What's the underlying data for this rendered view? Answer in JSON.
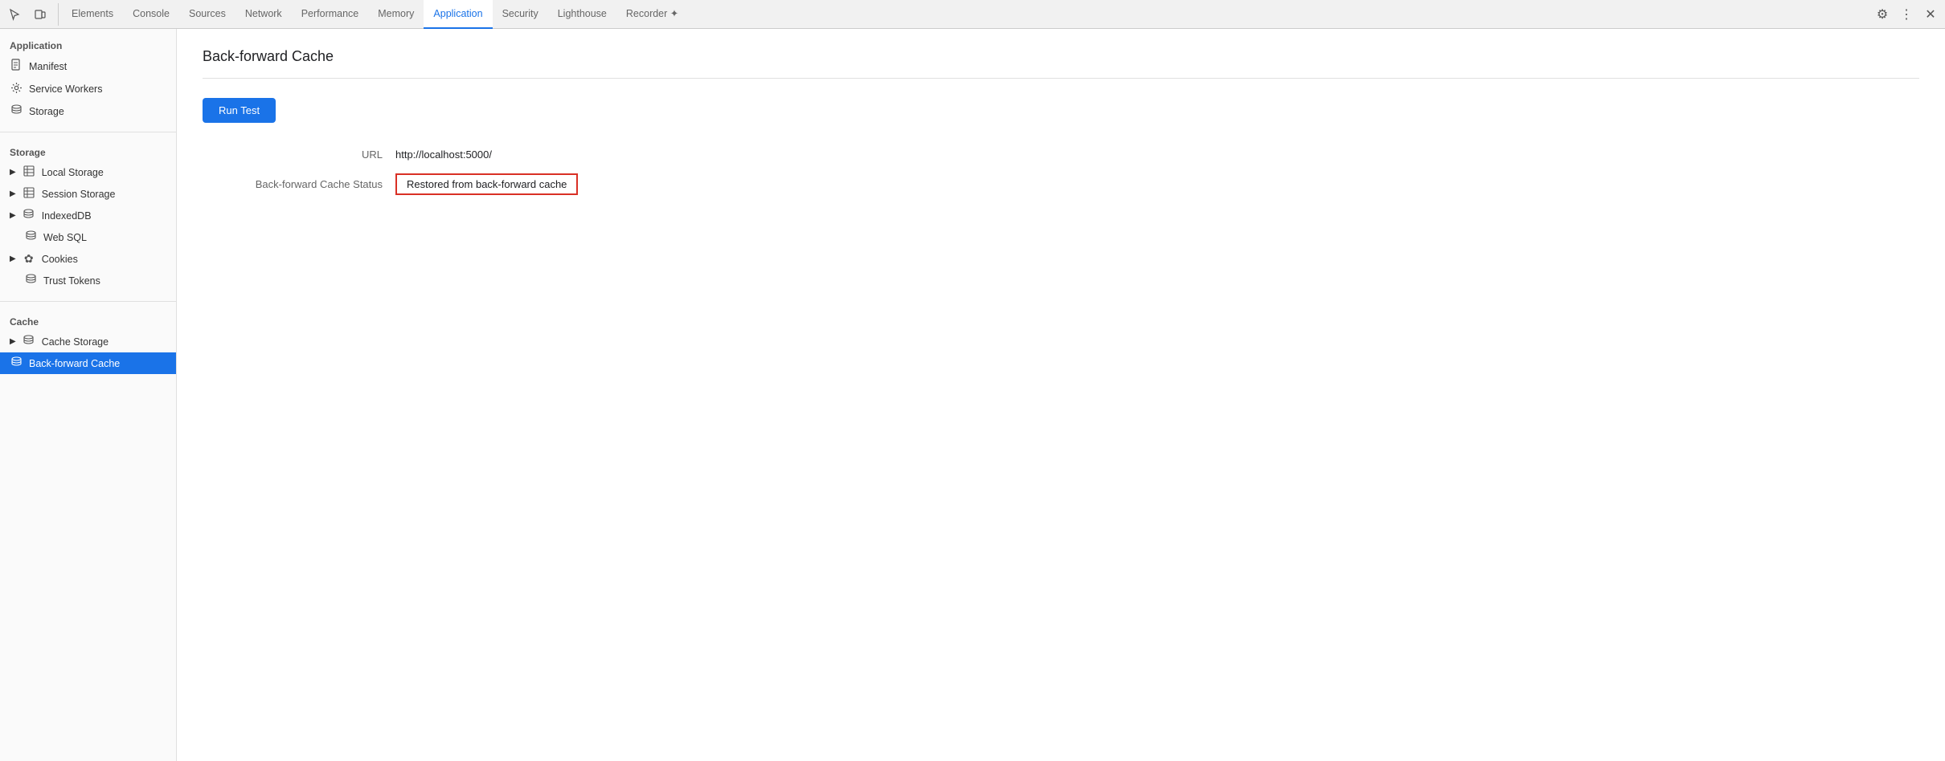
{
  "tabs": {
    "items": [
      {
        "label": "Elements",
        "active": false
      },
      {
        "label": "Console",
        "active": false
      },
      {
        "label": "Sources",
        "active": false
      },
      {
        "label": "Network",
        "active": false
      },
      {
        "label": "Performance",
        "active": false
      },
      {
        "label": "Memory",
        "active": false
      },
      {
        "label": "Application",
        "active": true
      },
      {
        "label": "Security",
        "active": false
      },
      {
        "label": "Lighthouse",
        "active": false
      },
      {
        "label": "Recorder ✦",
        "active": false
      }
    ]
  },
  "sidebar": {
    "application_header": "Application",
    "application_items": [
      {
        "label": "Manifest",
        "icon": "manifest"
      },
      {
        "label": "Service Workers",
        "icon": "gear"
      },
      {
        "label": "Storage",
        "icon": "storage"
      }
    ],
    "storage_header": "Storage",
    "storage_items": [
      {
        "label": "Local Storage",
        "icon": "table",
        "expandable": true
      },
      {
        "label": "Session Storage",
        "icon": "table",
        "expandable": true
      },
      {
        "label": "IndexedDB",
        "icon": "db",
        "expandable": true
      },
      {
        "label": "Web SQL",
        "icon": "db",
        "expandable": false
      },
      {
        "label": "Cookies",
        "icon": "cookie",
        "expandable": true
      },
      {
        "label": "Trust Tokens",
        "icon": "db",
        "expandable": false
      }
    ],
    "cache_header": "Cache",
    "cache_items": [
      {
        "label": "Cache Storage",
        "icon": "storage",
        "expandable": true
      },
      {
        "label": "Back-forward Cache",
        "icon": "storage",
        "active": true
      }
    ]
  },
  "content": {
    "title": "Back-forward Cache",
    "run_test_label": "Run Test",
    "url_label": "URL",
    "url_value": "http://localhost:5000/",
    "status_label": "Back-forward Cache Status",
    "status_value": "Restored from back-forward cache"
  }
}
